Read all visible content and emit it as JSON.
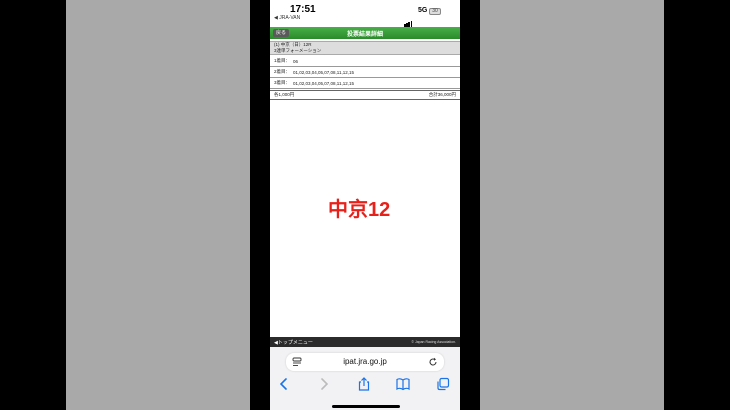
{
  "status_bar": {
    "time": "17:51",
    "back_app": "◀ JRA-VAN",
    "network": "5G",
    "battery": "30"
  },
  "header": {
    "back_label": "戻る",
    "title": "投票結果詳細"
  },
  "race": {
    "line1": "(1) 中京（日）12R",
    "line2": "3連単フォーメーション"
  },
  "rows": [
    {
      "label": "1着目：",
      "value": "06"
    },
    {
      "label": "2着目：",
      "value": "01,02,03,04,05,07,08,11,12,15"
    },
    {
      "label": "3着目：",
      "value": "01,02,03,04,05,07,08,11,12,15"
    }
  ],
  "totals": {
    "each": "各1,000円",
    "total": "合計36,000円"
  },
  "overlay_text": "中京12",
  "footer": {
    "top_menu": "◀トップメニュー",
    "copyright": "© Japan Racing Association."
  },
  "browser": {
    "url": "ipat.jra.go.jp"
  },
  "colors": {
    "header_green": "#2a8a2a",
    "overlay_red": "#e8201a",
    "ios_blue": "#1a73e8"
  }
}
